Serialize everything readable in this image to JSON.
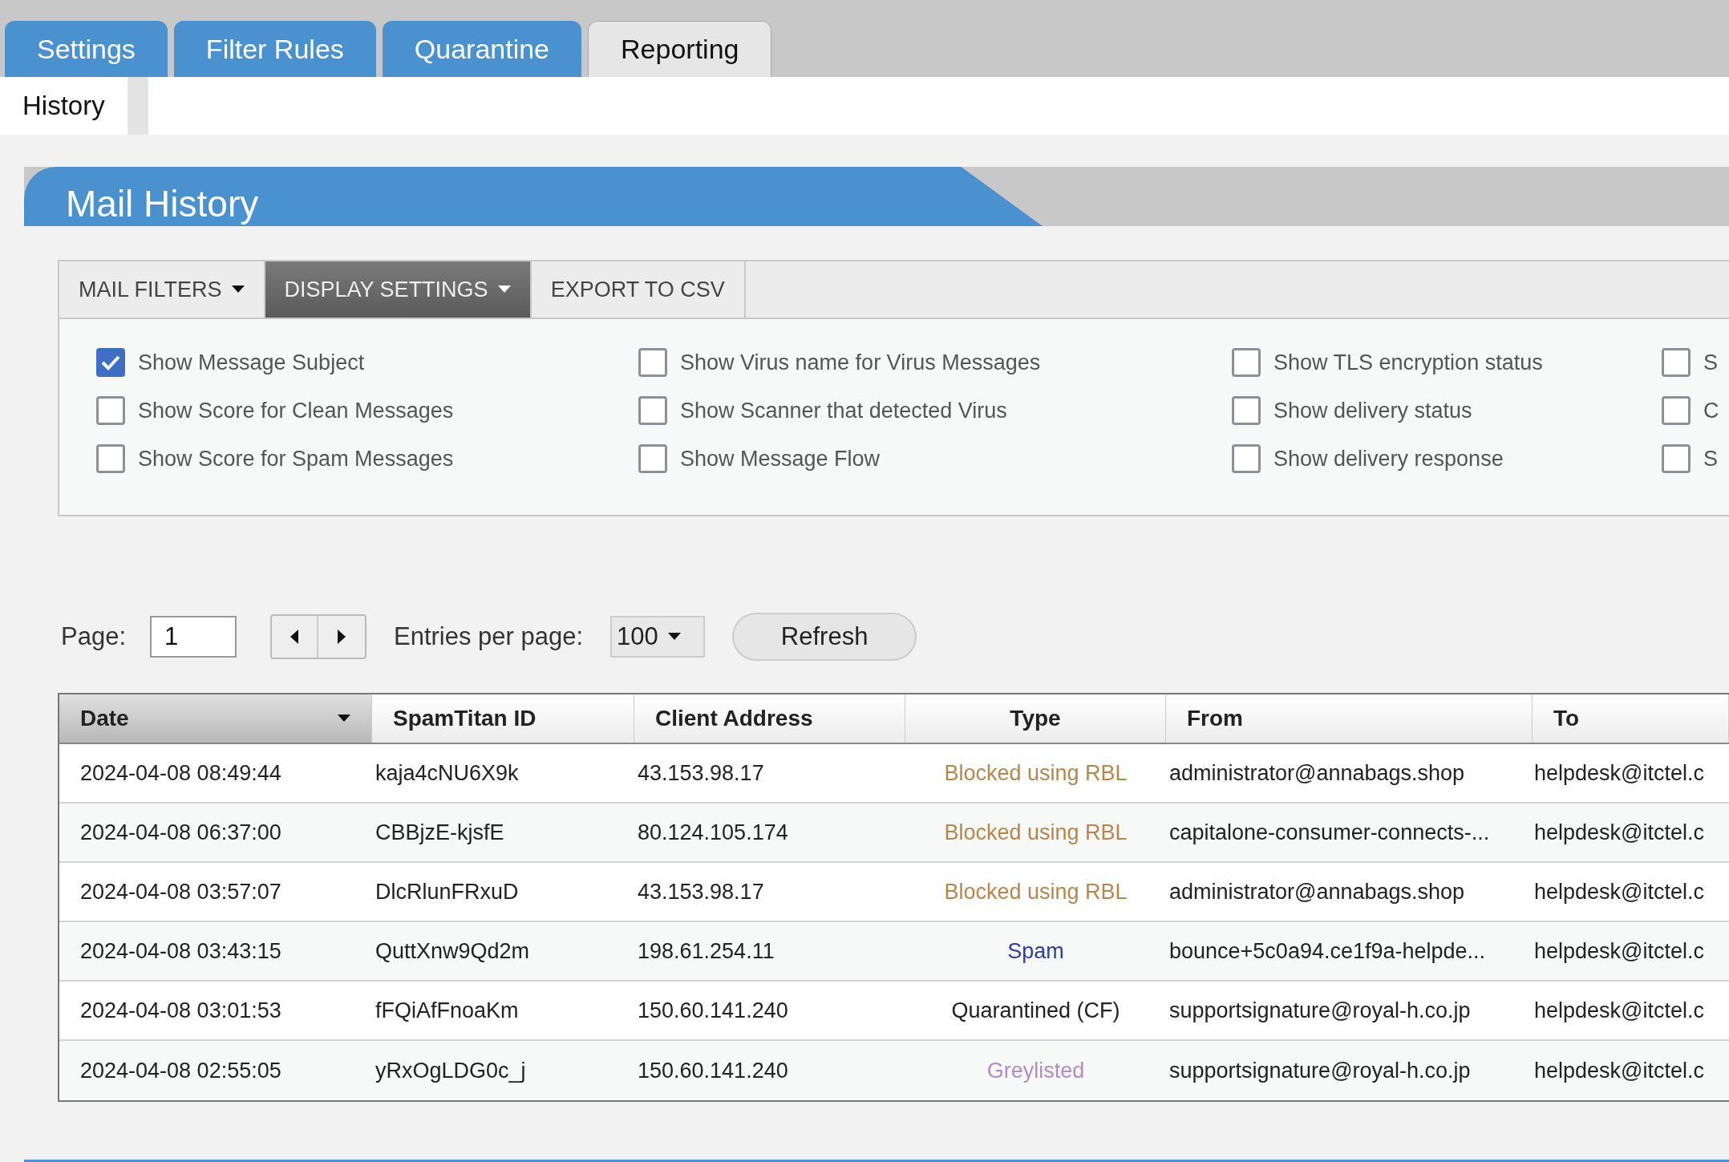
{
  "tabs": [
    {
      "label": "Settings",
      "selected": false
    },
    {
      "label": "Filter Rules",
      "selected": false
    },
    {
      "label": "Quarantine",
      "selected": false
    },
    {
      "label": "Reporting",
      "selected": true
    }
  ],
  "subtabs": [
    {
      "label": "History",
      "selected": true
    }
  ],
  "panel": {
    "title": "Mail History"
  },
  "toolbar": [
    {
      "label": "MAIL FILTERS",
      "selected": false,
      "dropdown": true
    },
    {
      "label": "DISPLAY SETTINGS",
      "selected": true,
      "dropdown": true
    },
    {
      "label": "EXPORT TO CSV",
      "selected": false,
      "dropdown": false
    }
  ],
  "options": [
    [
      {
        "label": "Show Message Subject",
        "checked": true
      },
      {
        "label": "Show Score for Clean Messages",
        "checked": false
      },
      {
        "label": "Show Score for Spam Messages",
        "checked": false
      }
    ],
    [
      {
        "label": "Show Virus name for Virus Messages",
        "checked": false
      },
      {
        "label": "Show Scanner that detected Virus",
        "checked": false
      },
      {
        "label": "Show Message Flow",
        "checked": false
      }
    ],
    [
      {
        "label": "Show TLS encryption status",
        "checked": false
      },
      {
        "label": "Show delivery status",
        "checked": false
      },
      {
        "label": "Show delivery response",
        "checked": false
      }
    ],
    [
      {
        "label": "S",
        "checked": false
      },
      {
        "label": "C",
        "checked": false
      },
      {
        "label": "S",
        "checked": false
      }
    ]
  ],
  "pager": {
    "page_label": "Page:",
    "page": "1",
    "entries_label": "Entries per page:",
    "entries": "100",
    "refresh": "Refresh"
  },
  "table": {
    "columns": [
      {
        "label": "Date",
        "sorted": true
      },
      {
        "label": "SpamTitan ID",
        "sorted": false
      },
      {
        "label": "Client Address",
        "sorted": false
      },
      {
        "label": "Type",
        "sorted": false
      },
      {
        "label": "From",
        "sorted": false
      },
      {
        "label": "To",
        "sorted": false
      }
    ],
    "rows": [
      {
        "date": "2024-04-08 08:49:44",
        "id": "kaja4cNU6X9k",
        "client": "43.153.98.17",
        "type": "Blocked using RBL",
        "color": "#b8864a",
        "from": "administrator@annabags.shop",
        "to": "helpdesk@itctel.c"
      },
      {
        "date": "2024-04-08 06:37:00",
        "id": "CBBjzE-kjsfE",
        "client": "80.124.105.174",
        "type": "Blocked using RBL",
        "color": "#b8864a",
        "from": "capitalone-consumer-connects-...",
        "to": "helpdesk@itctel.c"
      },
      {
        "date": "2024-04-08 03:57:07",
        "id": "DlcRlunFRxuD",
        "client": "43.153.98.17",
        "type": "Blocked using RBL",
        "color": "#b8864a",
        "from": "administrator@annabags.shop",
        "to": "helpdesk@itctel.c"
      },
      {
        "date": "2024-04-08 03:43:15",
        "id": "QuttXnw9Qd2m",
        "client": "198.61.254.11",
        "type": "Spam",
        "color": "#2b3e9e",
        "from": "bounce+5c0a94.ce1f9a-helpde...",
        "to": "helpdesk@itctel.c"
      },
      {
        "date": "2024-04-08 03:01:53",
        "id": "fFQiAfFnoaKm",
        "client": "150.60.141.240",
        "type": "Quarantined (CF)",
        "color": "#222222",
        "from": "supportsignature@royal-h.co.jp",
        "to": "helpdesk@itctel.c"
      },
      {
        "date": "2024-04-08 02:55:05",
        "id": "yRxOgLDG0c_j",
        "client": "150.60.141.240",
        "type": "Greylisted",
        "color": "#b38bc9",
        "from": "supportsignature@royal-h.co.jp",
        "to": "helpdesk@itctel.c"
      }
    ]
  }
}
